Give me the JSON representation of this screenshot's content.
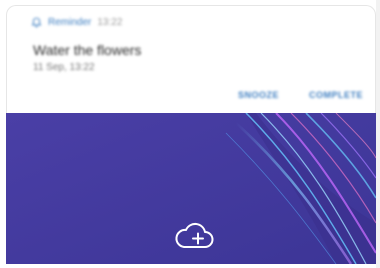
{
  "notification": {
    "app_name": "Reminder",
    "time": "13:22",
    "title": "Water the flowers",
    "subtitle": "11 Sep, 13:22",
    "actions": [
      "SNOOZE",
      "COMPLETE"
    ],
    "icon": "bell-icon",
    "accent_color": "#3f7fc1"
  },
  "wallpaper": {
    "base_color": "#4b3fa7",
    "add_icon": "cloud-add-icon"
  }
}
